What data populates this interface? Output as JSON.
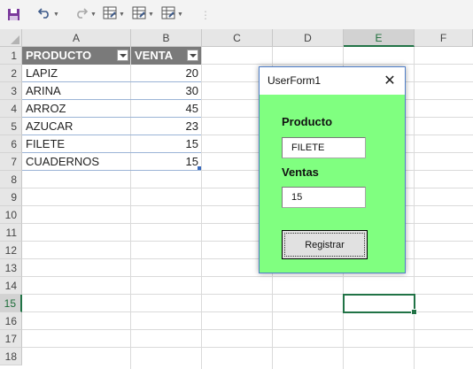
{
  "toolbar": {
    "items": [
      {
        "name": "save-icon",
        "glyph": "💾"
      },
      {
        "name": "undo-icon",
        "glyph": "↶"
      },
      {
        "name": "redo-icon",
        "glyph": "↷"
      },
      {
        "name": "format-icon",
        "glyph": "▦"
      }
    ]
  },
  "sheet": {
    "columns": [
      "A",
      "B",
      "C",
      "D",
      "E",
      "F"
    ],
    "rows": [
      "1",
      "2",
      "3",
      "4",
      "5",
      "6",
      "7",
      "8",
      "9",
      "10",
      "11",
      "12",
      "13",
      "14",
      "15",
      "16",
      "17",
      "18"
    ],
    "active_cell": "E15",
    "table": {
      "headers": [
        "PRODUCTO",
        "VENTA"
      ],
      "rows": [
        [
          "LAPIZ",
          "20"
        ],
        [
          "ARINA",
          "30"
        ],
        [
          "ARROZ",
          "45"
        ],
        [
          "AZUCAR",
          "23"
        ],
        [
          "FILETE",
          "15"
        ],
        [
          "CUADERNOS",
          "15"
        ]
      ]
    }
  },
  "userform": {
    "title": "UserForm1",
    "close_glyph": "✕",
    "producto_label": "Producto",
    "producto_value": "FILETE",
    "ventas_label": "Ventas",
    "ventas_value": "15",
    "button_label": "Registrar",
    "background_color": "#80FF80"
  }
}
